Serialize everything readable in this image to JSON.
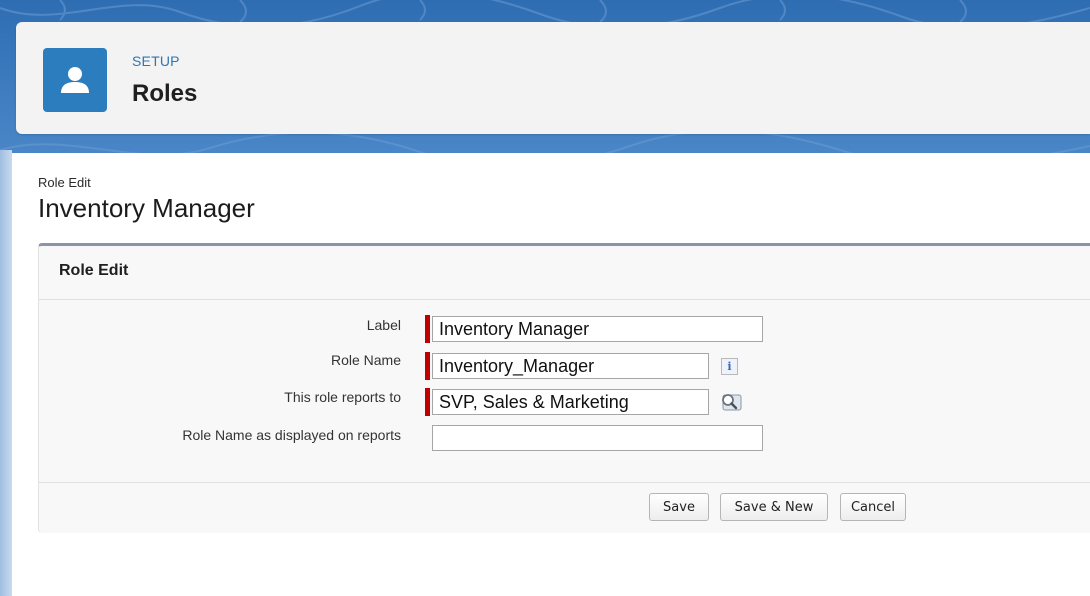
{
  "header": {
    "eyebrow": "SETUP",
    "title": "Roles",
    "icon": "user-icon"
  },
  "page": {
    "breadcrumb": "Role Edit",
    "title": "Inventory Manager"
  },
  "panel": {
    "title": "Role Edit",
    "fields": [
      {
        "label": "Label",
        "value": "Inventory Manager",
        "required": true
      },
      {
        "label": "Role Name",
        "value": "Inventory_Manager",
        "required": true,
        "icon": "info-icon"
      },
      {
        "label": "This role reports to",
        "value": "SVP, Sales & Marketing",
        "required": true,
        "icon": "lookup-icon"
      },
      {
        "label": "Role Name as displayed on reports",
        "value": "",
        "required": false
      }
    ],
    "buttons": {
      "save": "Save",
      "save_new": "Save & New",
      "cancel": "Cancel"
    },
    "info_glyph": "i"
  },
  "colors": {
    "brand_blue": "#2c7dbd",
    "required_marker": "#c00000",
    "link_blue": "#2f75b5"
  }
}
